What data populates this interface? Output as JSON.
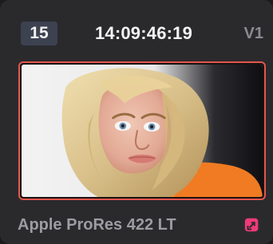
{
  "clip": {
    "number": "15",
    "timecode": "14:09:46:19",
    "track": "V1",
    "codec": "Apple ProRes 422 LT"
  },
  "icons": {
    "thumbnail": "portrait-thumbnail",
    "external": "external-link-icon"
  },
  "colors": {
    "selection_border": "#e2574c",
    "external_icon": "#ef3a78"
  }
}
